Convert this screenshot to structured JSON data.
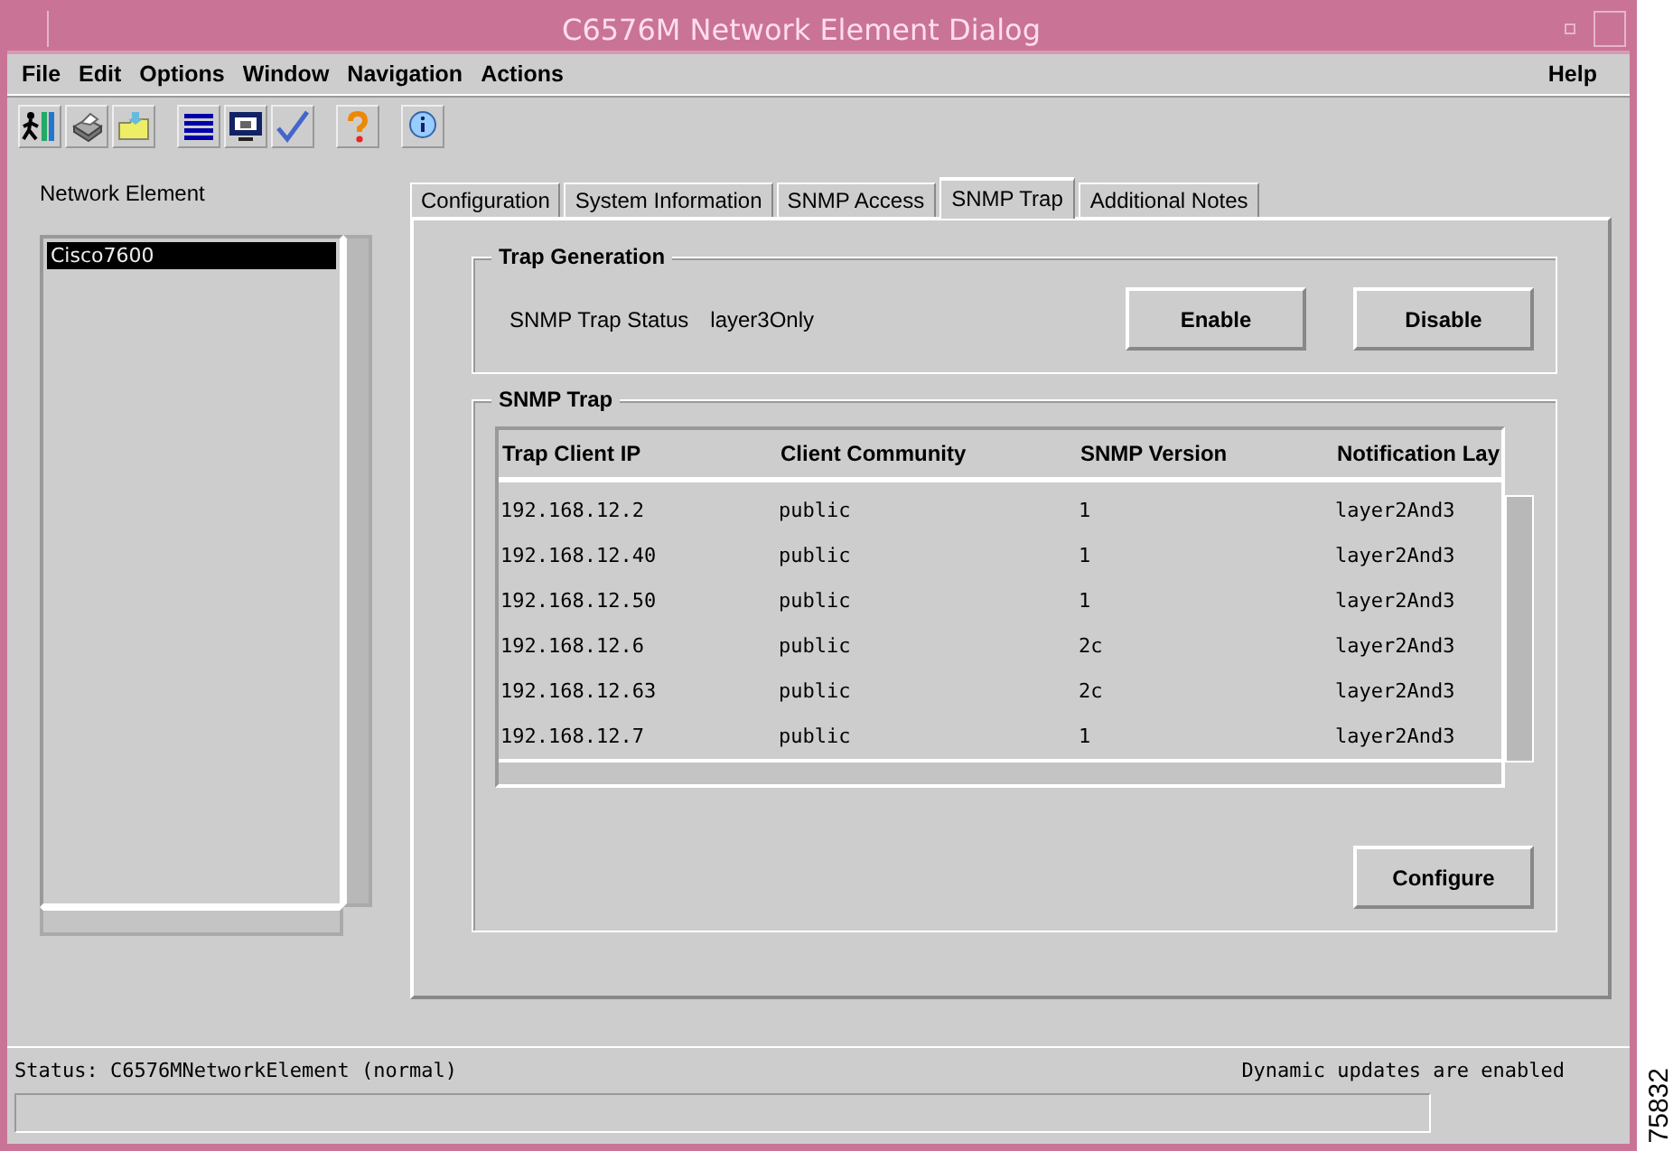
{
  "window": {
    "title": "C6576M Network Element Dialog"
  },
  "menu": {
    "items": [
      "File",
      "Edit",
      "Options",
      "Window",
      "Navigation",
      "Actions"
    ],
    "help": "Help"
  },
  "toolbar": {
    "groups": [
      [
        {
          "kind": "exit"
        },
        {
          "kind": "print"
        },
        {
          "kind": "open"
        }
      ],
      [
        {
          "kind": "list"
        },
        {
          "kind": "monitor"
        },
        {
          "kind": "check"
        }
      ],
      [
        {
          "kind": "help"
        }
      ],
      [
        {
          "kind": "info"
        }
      ]
    ]
  },
  "network_element": {
    "label": "Network Element",
    "items": [
      {
        "label": "Cisco7600",
        "selected": true
      }
    ]
  },
  "tabs": [
    {
      "label": "Configuration",
      "selected": false
    },
    {
      "label": "System Information",
      "selected": false
    },
    {
      "label": "SNMP Access",
      "selected": false
    },
    {
      "label": "SNMP Trap",
      "selected": true
    },
    {
      "label": "Additional Notes",
      "selected": false
    }
  ],
  "trap_generation": {
    "title": "Trap Generation",
    "status_label": "SNMP Trap Status",
    "status_value": "layer3Only",
    "buttons": [
      "Enable",
      "Disable"
    ]
  },
  "snmp_trap": {
    "title": "SNMP Trap",
    "columns": [
      "Trap Client IP",
      "Client Community",
      "SNMP Version",
      "Notification Lay"
    ],
    "rows": [
      [
        "192.168.12.2",
        "public",
        "1",
        "layer2And3"
      ],
      [
        "192.168.12.40",
        "public",
        "1",
        "layer2And3"
      ],
      [
        "192.168.12.50",
        "public",
        "1",
        "layer2And3"
      ],
      [
        "192.168.12.6",
        "public",
        "2c",
        "layer2And3"
      ],
      [
        "192.168.12.63",
        "public",
        "2c",
        "layer2And3"
      ],
      [
        "192.168.12.7",
        "public",
        "1",
        "layer2And3"
      ]
    ],
    "button": "Configure"
  },
  "status_bar": {
    "status": "Status: C6576MNetworkElement (normal)",
    "updates": "Dynamic updates are enabled"
  },
  "figure_id": "75832"
}
